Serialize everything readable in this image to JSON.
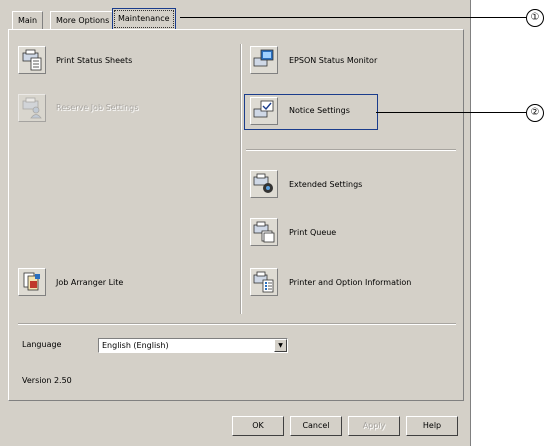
{
  "tabs": [
    {
      "label": "Main"
    },
    {
      "label": "More Options"
    },
    {
      "label": "Maintenance"
    }
  ],
  "left_items": {
    "print_status_sheets": "Print Status Sheets",
    "reserve_job_settings": "Reserve Job Settings",
    "job_arranger_lite": "Job Arranger Lite"
  },
  "right_items": {
    "epson_status_monitor": "EPSON Status Monitor",
    "notice_settings": "Notice Settings",
    "extended_settings": "Extended Settings",
    "print_queue": "Print Queue",
    "printer_option_info": "Printer and Option Information"
  },
  "language": {
    "label": "Language",
    "value": "English (English)"
  },
  "version": "Version 2.50",
  "buttons": {
    "ok": "OK",
    "cancel": "Cancel",
    "apply": "Apply",
    "help": "Help"
  },
  "callouts": [
    "①",
    "②"
  ]
}
